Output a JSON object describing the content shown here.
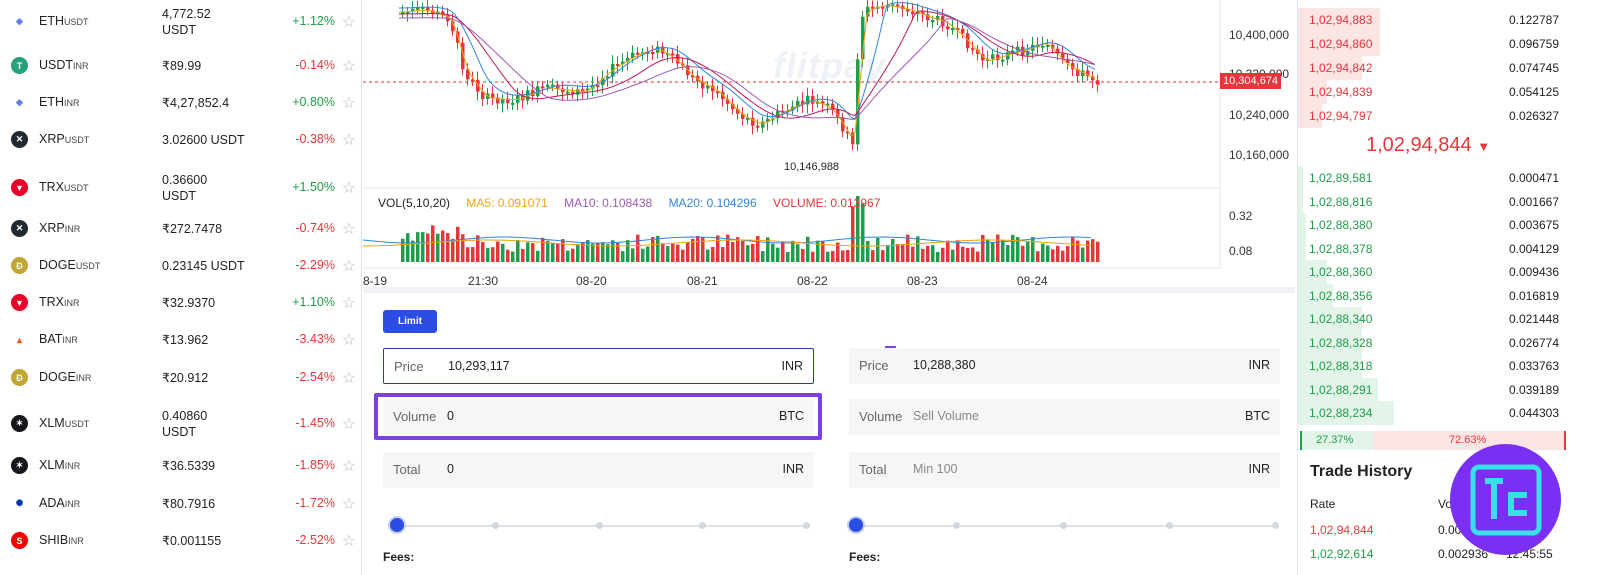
{
  "markets": [
    {
      "base": "ETH",
      "quote": "USDT",
      "price": "4,772.52",
      "price2": "USDT",
      "change": "+1.12%",
      "icon": "eth-icon",
      "color": "#ffffff",
      "dir": "pos"
    },
    {
      "base": "USDT",
      "quote": "INR",
      "price": "₹89.99",
      "price2": "",
      "change": "-0.14%",
      "icon": "tether-icon",
      "color": "#26a17b",
      "dir": "neg"
    },
    {
      "base": "ETH",
      "quote": "INR",
      "price": "₹4,27,852.4",
      "price2": "",
      "change": "+0.80%",
      "icon": "eth-icon",
      "color": "#ffffff",
      "dir": "pos"
    },
    {
      "base": "XRP",
      "quote": "USDT",
      "price": "3.02600 USDT",
      "price2": "",
      "change": "-0.38%",
      "icon": "xrp-icon",
      "color": "#23292f",
      "dir": "neg"
    },
    {
      "base": "TRX",
      "quote": "USDT",
      "price": "0.36600",
      "price2": "USDT",
      "change": "+1.50%",
      "icon": "tron-icon",
      "color": "#eb0029",
      "dir": "pos"
    },
    {
      "base": "XRP",
      "quote": "INR",
      "price": "₹272.7478",
      "price2": "",
      "change": "-0.74%",
      "icon": "xrp-icon",
      "color": "#23292f",
      "dir": "neg"
    },
    {
      "base": "DOGE",
      "quote": "USDT",
      "price": "0.23145 USDT",
      "price2": "",
      "change": "-2.29%",
      "icon": "doge-icon",
      "color": "#c2a633",
      "dir": "neg"
    },
    {
      "base": "TRX",
      "quote": "INR",
      "price": "₹32.9370",
      "price2": "",
      "change": "+1.10%",
      "icon": "tron-icon",
      "color": "#eb0029",
      "dir": "pos"
    },
    {
      "base": "BAT",
      "quote": "INR",
      "price": "₹13.962",
      "price2": "",
      "change": "-3.43%",
      "icon": "bat-icon",
      "color": "#ffffff",
      "dir": "neg"
    },
    {
      "base": "DOGE",
      "quote": "INR",
      "price": "₹20.912",
      "price2": "",
      "change": "-2.54%",
      "icon": "doge-icon",
      "color": "#c2a633",
      "dir": "neg"
    },
    {
      "base": "XLM",
      "quote": "USDT",
      "price": "0.40860",
      "price2": "USDT",
      "change": "-1.45%",
      "icon": "stellar-icon",
      "color": "#14161b",
      "dir": "neg"
    },
    {
      "base": "XLM",
      "quote": "INR",
      "price": "₹36.5339",
      "price2": "",
      "change": "-1.85%",
      "icon": "stellar-icon",
      "color": "#14161b",
      "dir": "neg"
    },
    {
      "base": "ADA",
      "quote": "INR",
      "price": "₹80.7916",
      "price2": "",
      "change": "-1.72%",
      "icon": "cardano-icon",
      "color": "#ffffff",
      "dir": "neg"
    },
    {
      "base": "SHIB",
      "quote": "INR",
      "price": "₹0.001155",
      "price2": "",
      "change": "-2.52%",
      "icon": "shib-icon",
      "color": "#f00500",
      "dir": "neg"
    }
  ],
  "chart": {
    "watermark": "flitpay",
    "price_axis": [
      "10,400,000",
      "10,320,000",
      "10,240,000",
      "10,160,000"
    ],
    "current_price_tag": "10,304,674",
    "low_label": "10,146,988",
    "vol_legend": {
      "vol": "VOL(5,10,20)",
      "ma5": "MA5: 0.091071",
      "ma10": "MA10: 0.108438",
      "ma20": "MA20: 0.104296",
      "volume": "VOLUME: 0.013967"
    },
    "vol_axis": [
      "0.32",
      "0.08"
    ],
    "x_labels": [
      "8-19",
      "21:30",
      "08-20",
      "08-21",
      "08-22",
      "08-23",
      "08-24"
    ],
    "colors": {
      "up": "#1f9d4a",
      "down": "#e5373a",
      "ma5": "#f0a30a",
      "ma10": "#9b59b6",
      "ma20": "#2e86de",
      "ma_long": "#c2185b"
    }
  },
  "order_form": {
    "limit_label": "Limit",
    "buy": {
      "price_label": "Price",
      "price_value": "10,293,117",
      "price_unit": "INR",
      "volume_label": "Volume",
      "volume_value": "0",
      "volume_unit": "BTC",
      "total_label": "Total",
      "total_value": "0",
      "total_unit": "INR"
    },
    "sell": {
      "price_label": "Price",
      "price_value": "10,288,380",
      "price_unit": "INR",
      "volume_label": "Volume",
      "volume_placeholder": "Sell Volume",
      "volume_unit": "BTC",
      "total_label": "Total",
      "total_placeholder": "Min 100",
      "total_unit": "INR"
    },
    "buy_slider_pct": 0,
    "sell_slider_pct": 0,
    "fees_label": "Fees:"
  },
  "order_book": {
    "asks": [
      {
        "price": "1,02,94,883",
        "qty": "0.122787",
        "depth": 0.31
      },
      {
        "price": "1,02,94,860",
        "qty": "0.096759",
        "depth": 0.31
      },
      {
        "price": "1,02,94,842",
        "qty": "0.074745",
        "depth": 0.24
      },
      {
        "price": "1,02,94,839",
        "qty": "0.054125",
        "depth": 0.11
      },
      {
        "price": "1,02,94,797",
        "qty": "0.026327",
        "depth": 0.09
      }
    ],
    "mid_price": "1,02,94,844",
    "bids": [
      {
        "price": "1,02,89,581",
        "qty": "0.000471",
        "depth": 0.02
      },
      {
        "price": "1,02,88,816",
        "qty": "0.001667",
        "depth": 0.02
      },
      {
        "price": "1,02,88,380",
        "qty": "0.003675",
        "depth": 0.03
      },
      {
        "price": "1,02,88,378",
        "qty": "0.004129",
        "depth": 0.03
      },
      {
        "price": "1,02,88,360",
        "qty": "0.009436",
        "depth": 0.11
      },
      {
        "price": "1,02,88,356",
        "qty": "0.016819",
        "depth": 0.13
      },
      {
        "price": "1,02,88,340",
        "qty": "0.021448",
        "depth": 0.24
      },
      {
        "price": "1,02,88,328",
        "qty": "0.026774",
        "depth": 0.24
      },
      {
        "price": "1,02,88,318",
        "qty": "0.033763",
        "depth": 0.24
      },
      {
        "price": "1,02,88,291",
        "qty": "0.039189",
        "depth": 0.3
      },
      {
        "price": "1,02,88,234",
        "qty": "0.044303",
        "depth": 0.36
      }
    ],
    "buy_ratio": "27.37%",
    "sell_ratio": "72.63%",
    "buy_ratio_value": 0.2737
  },
  "trade_history": {
    "title": "Trade History",
    "col_rate": "Rate",
    "col_volume": "Vo",
    "rows": [
      {
        "rate": "1,02,94,844",
        "volume": "0.003",
        "time": "",
        "dir": "neg"
      },
      {
        "rate": "1,02,92,614",
        "volume": "0.002936",
        "time": "12:45:55",
        "dir": "pos"
      }
    ]
  }
}
